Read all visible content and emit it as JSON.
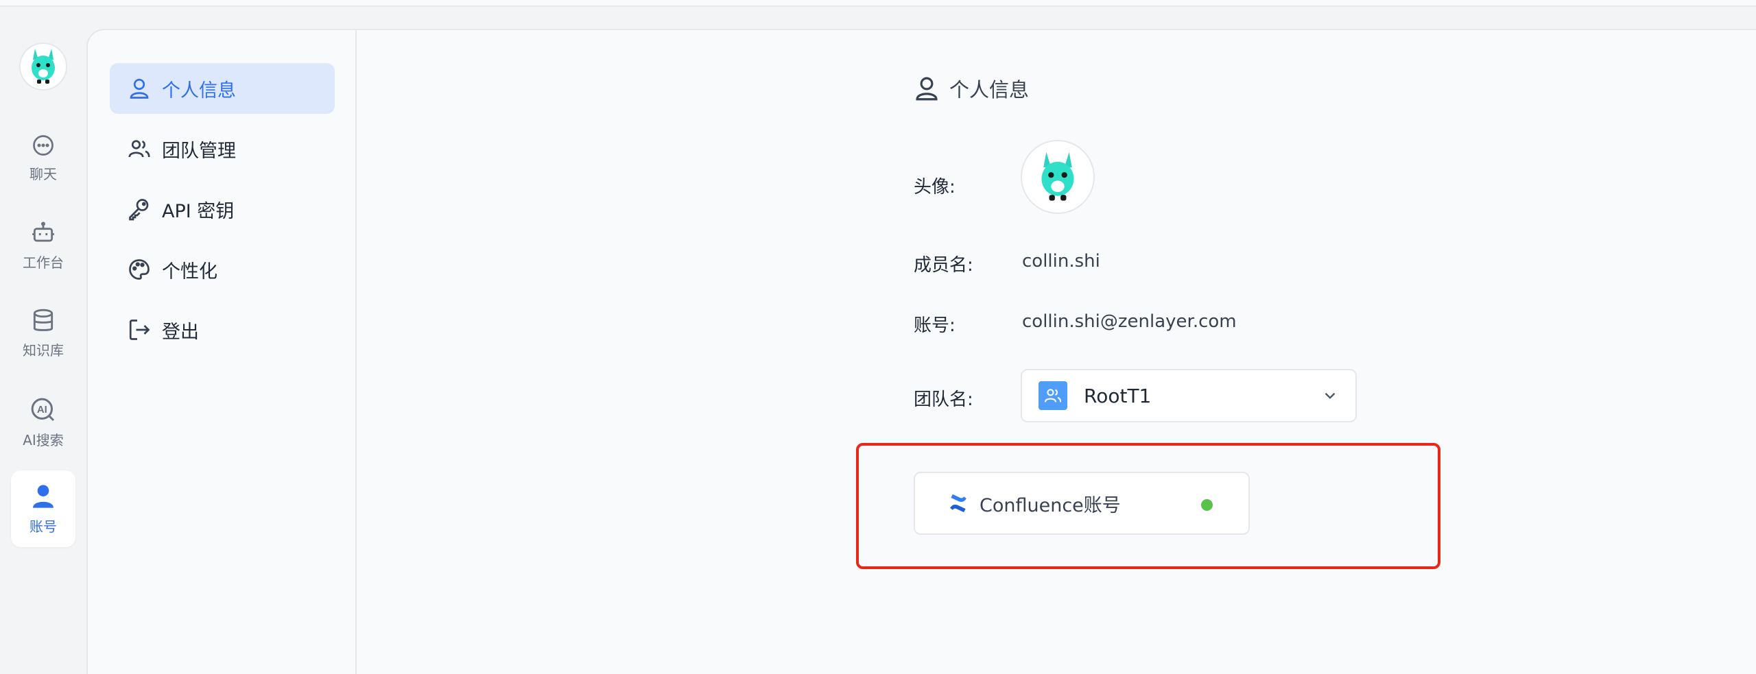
{
  "rail": {
    "items": [
      {
        "label": "聊天",
        "icon": "chat-bubble-icon"
      },
      {
        "label": "工作台",
        "icon": "robot-icon"
      },
      {
        "label": "知识库",
        "icon": "database-icon"
      },
      {
        "label": "AI搜索",
        "icon": "ai-search-icon"
      },
      {
        "label": "账号",
        "icon": "user-icon",
        "active": true
      }
    ]
  },
  "menu": {
    "items": [
      {
        "label": "个人信息",
        "icon": "user-outline-icon",
        "active": true
      },
      {
        "label": "团队管理",
        "icon": "team-icon"
      },
      {
        "label": "API 密钥",
        "icon": "key-icon"
      },
      {
        "label": "个性化",
        "icon": "palette-icon"
      },
      {
        "label": "登出",
        "icon": "logout-icon"
      }
    ]
  },
  "profile": {
    "title": "个人信息",
    "avatar_label": "头像:",
    "member_label": "成员名:",
    "member_value": "collin.shi",
    "account_label": "账号:",
    "account_value": "collin.shi@zenlayer.com",
    "team_label": "团队名:",
    "team_value": "RootT1"
  },
  "integration": {
    "name": "Confluence账号",
    "icon": "confluence-icon",
    "status_color": "#58c24a"
  },
  "colors": {
    "accent": "#2f6fec",
    "highlight": "#e8261a",
    "active_bg": "#dde8fd"
  }
}
